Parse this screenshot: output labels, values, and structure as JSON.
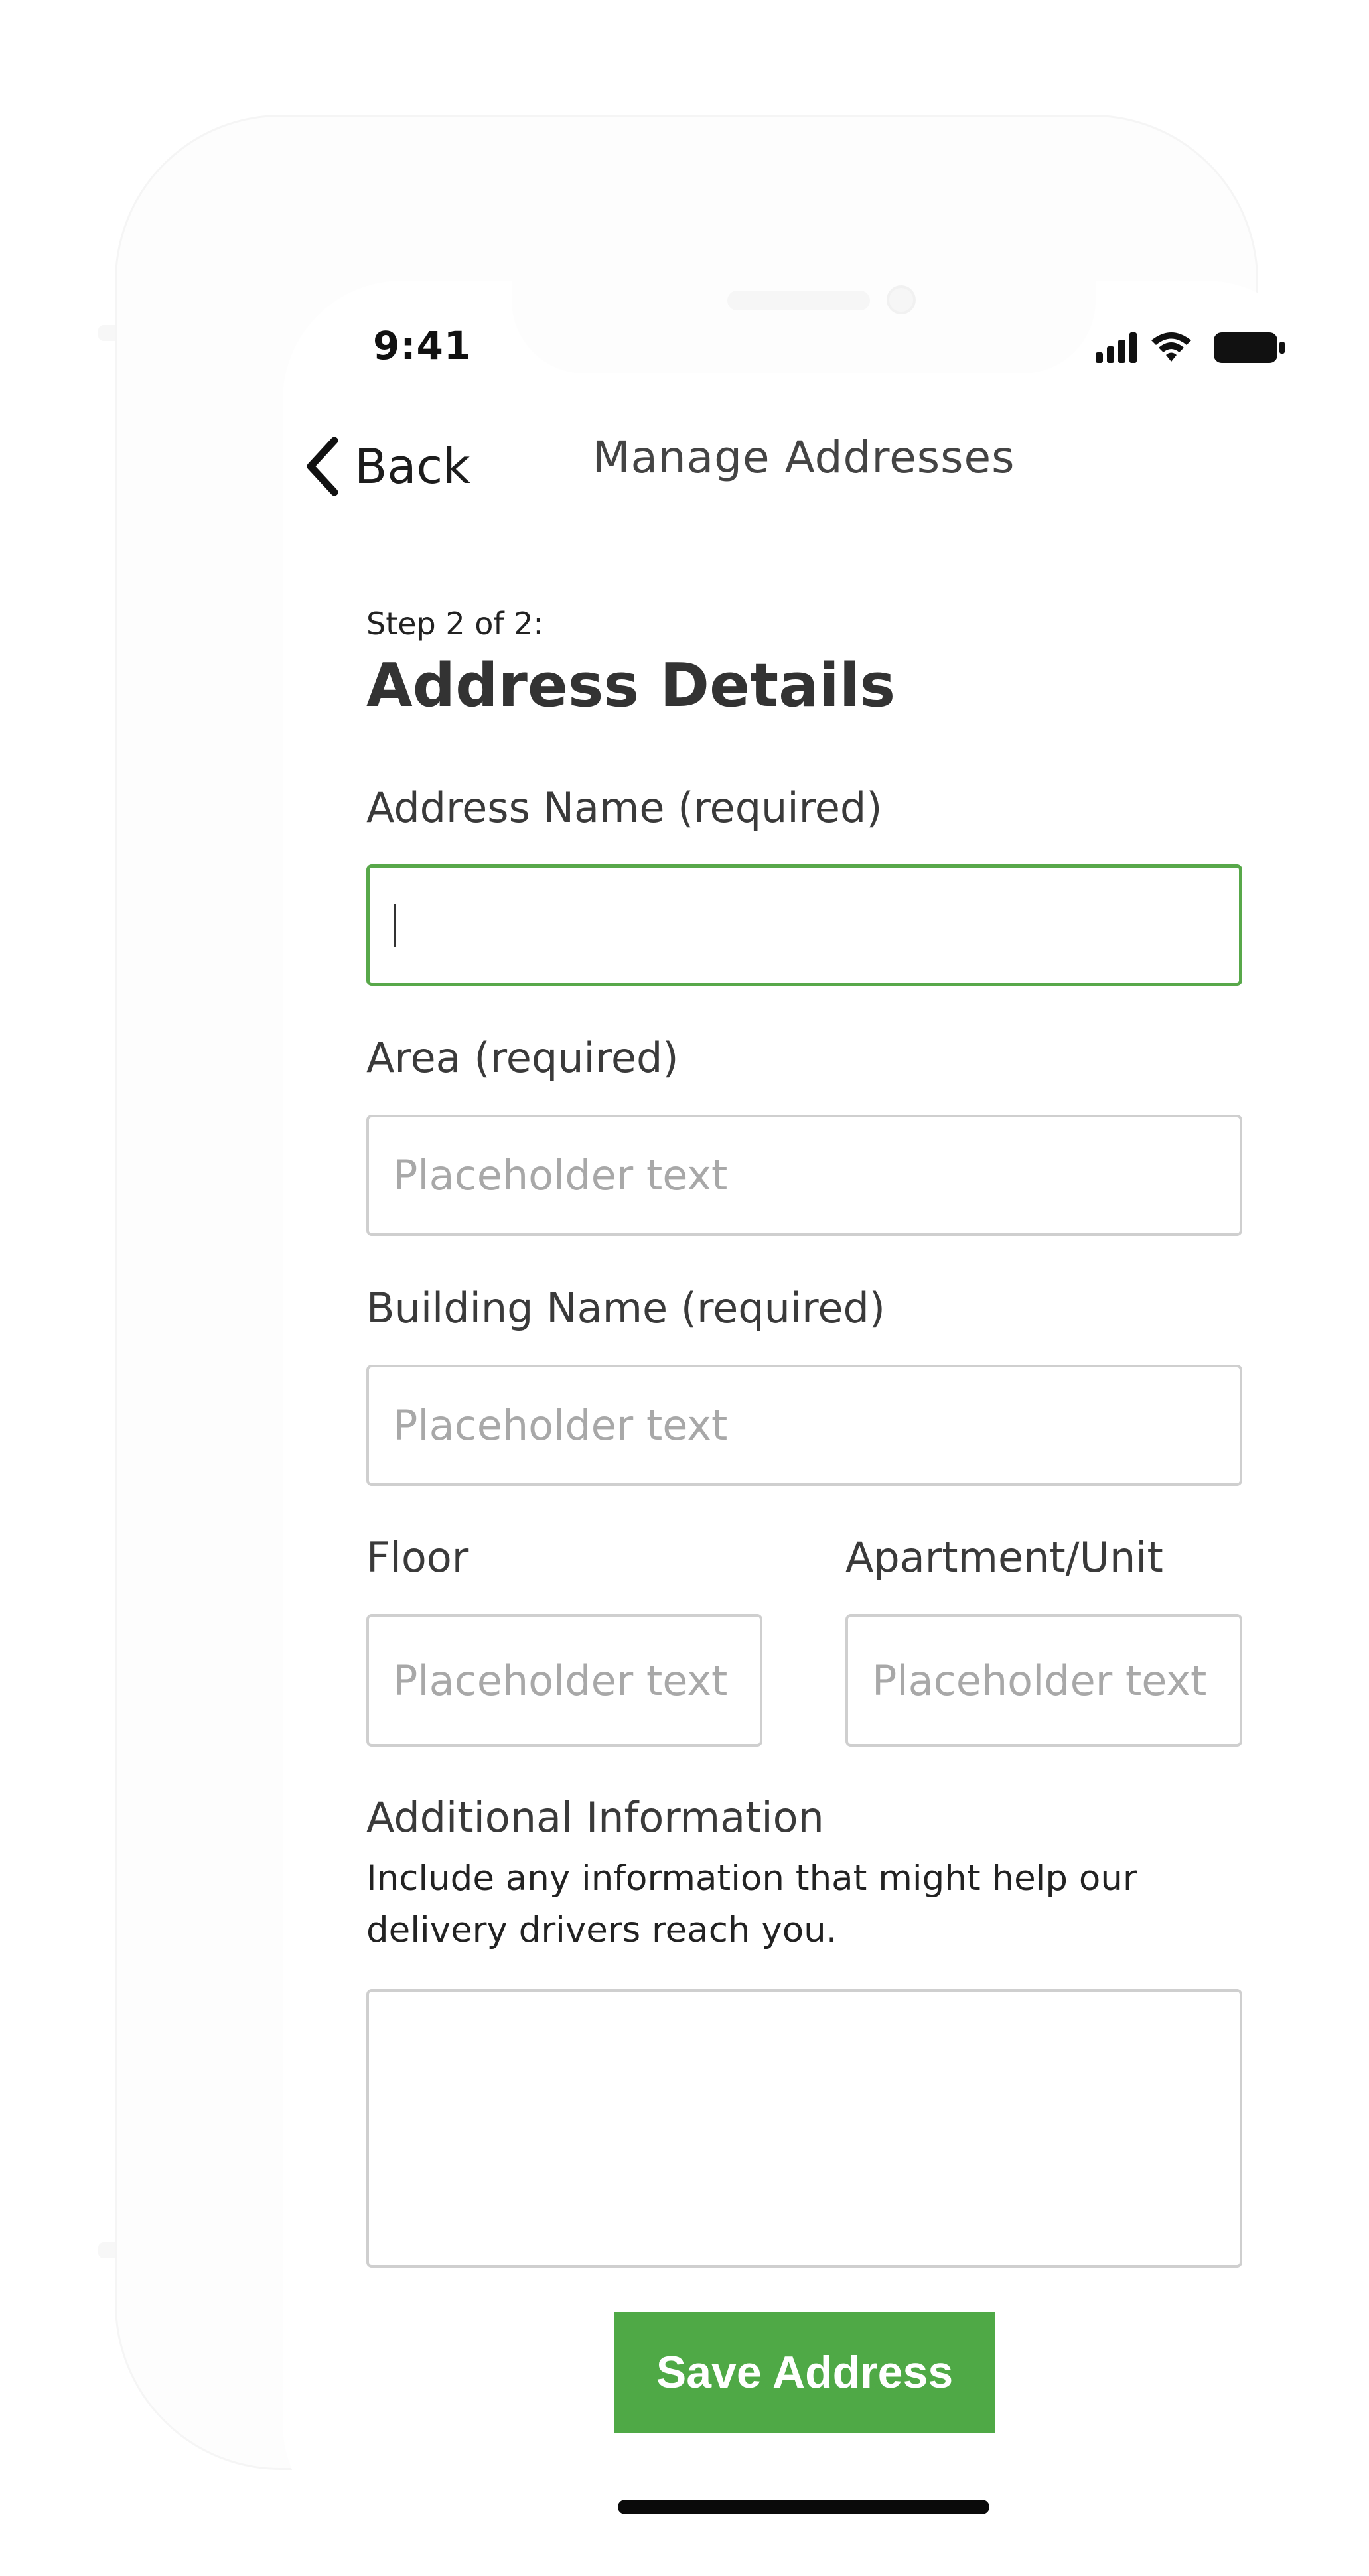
{
  "status_bar": {
    "time": "9:41"
  },
  "nav": {
    "back_label": "Back",
    "title": "Manage Addresses"
  },
  "form": {
    "step": "Step 2 of 2:",
    "heading": "Address Details",
    "address_name": {
      "label": "Address Name (required)",
      "value": ""
    },
    "area": {
      "label": "Area  (required)",
      "placeholder": "Placeholder text"
    },
    "building": {
      "label": "Building Name (required)",
      "placeholder": "Placeholder text"
    },
    "floor": {
      "label": "Floor",
      "placeholder": "Placeholder text"
    },
    "apartment": {
      "label": "Apartment/Unit",
      "placeholder": "Placeholder text"
    },
    "additional": {
      "label": "Additional Information",
      "helper": "Include any information that might help our delivery drivers reach you.",
      "value": ""
    }
  },
  "save_button": {
    "label": "Save Address"
  },
  "colors": {
    "accent": "#4fa946",
    "active_border": "#58a84a"
  }
}
